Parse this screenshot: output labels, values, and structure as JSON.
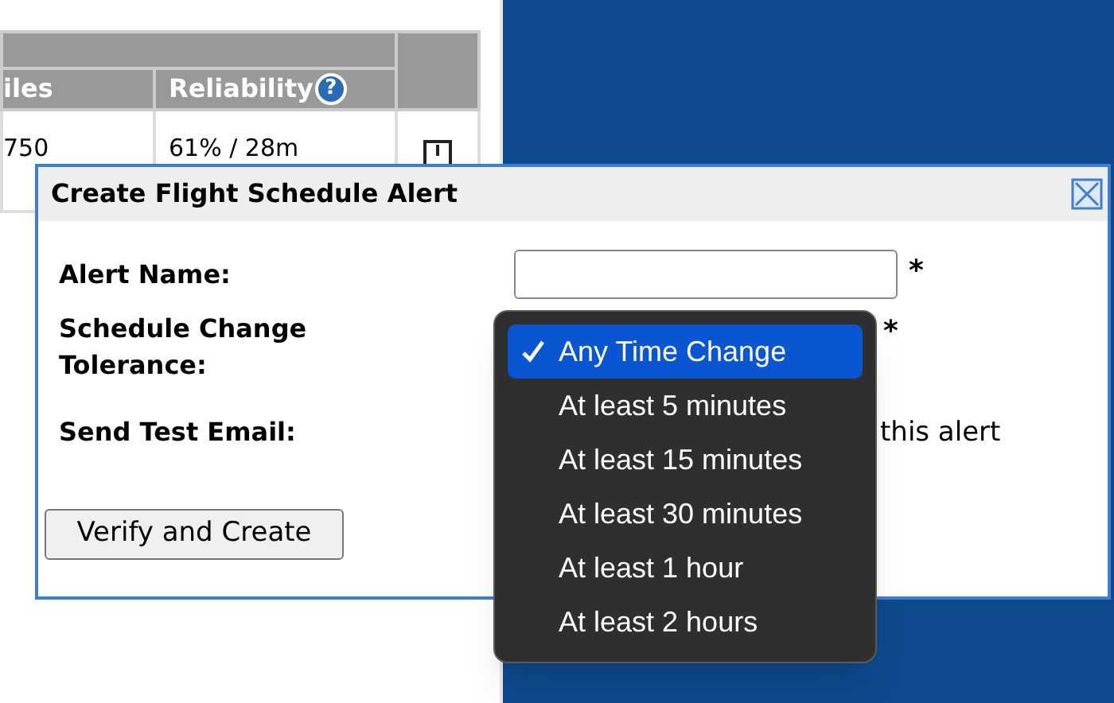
{
  "background_table": {
    "columns": [
      {
        "label": "iles"
      },
      {
        "label": "Reliability",
        "help_icon": "?"
      }
    ],
    "rows": [
      {
        "cells": [
          "750",
          "61% / 28m"
        ]
      }
    ]
  },
  "dialog": {
    "title": "Create Flight Schedule Alert",
    "fields": [
      {
        "kind": "text",
        "label": "Alert Name:",
        "required_mark": "*"
      },
      {
        "kind": "select",
        "label": "Schedule Change Tolerance:",
        "required_mark": "*"
      },
      {
        "kind": "checkbox",
        "label": "Send Test Email:",
        "text": "this alert"
      }
    ],
    "button": "Verify and Create"
  },
  "dropdown": {
    "options": [
      {
        "label": "Any Time Change",
        "selected": true
      },
      {
        "label": "At least 5 minutes",
        "selected": false
      },
      {
        "label": "At least 15 minutes",
        "selected": false
      },
      {
        "label": "At least 30 minutes",
        "selected": false
      },
      {
        "label": "At least 1 hour",
        "selected": false
      },
      {
        "label": "At least 2 hours",
        "selected": false
      }
    ]
  }
}
